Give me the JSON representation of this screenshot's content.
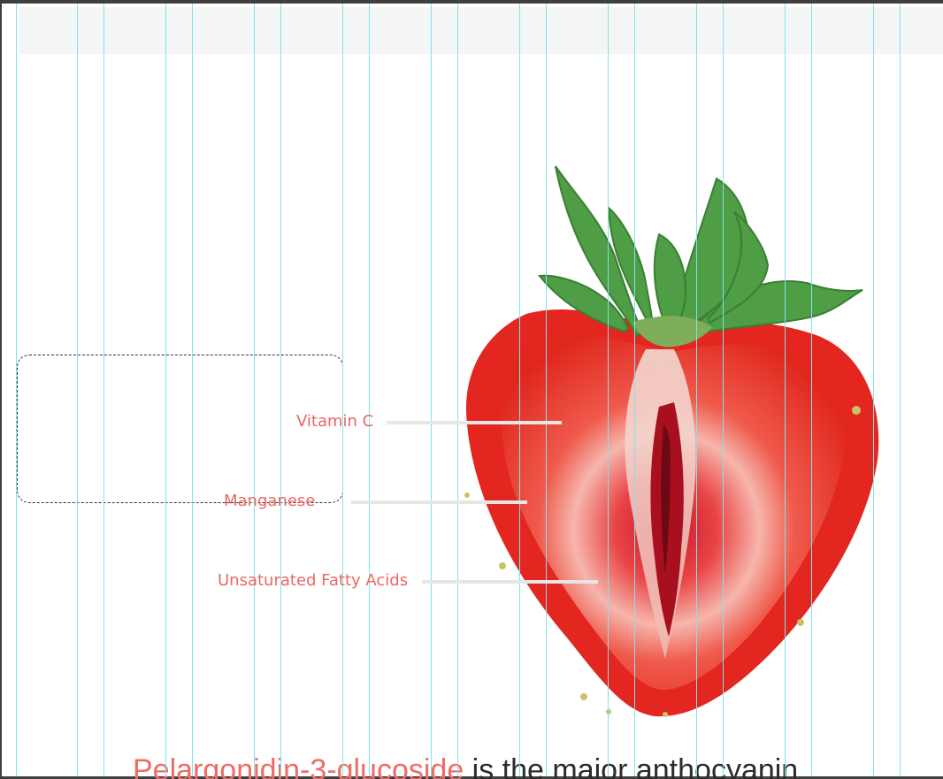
{
  "canvas": {
    "guide_color": "#7fe3ec",
    "topbar_color": "#f4f5f5"
  },
  "image": {
    "subject": "halved-strawberry"
  },
  "labels": {
    "vitamin_c": "Vitamin C",
    "manganese": "Manganese",
    "fatty_acids": "Unsaturated Fatty Acids"
  },
  "caption": {
    "highlight": "Pelargonidin-3-glucoside",
    "rest": " is the major anthocyanin"
  },
  "colors": {
    "label": "#e96864",
    "highlight": "#ef6b67",
    "text": "#2b2b2b",
    "leader": "#e6e6e6"
  }
}
